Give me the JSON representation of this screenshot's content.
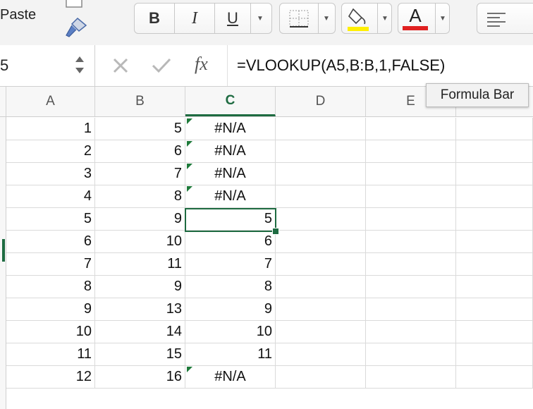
{
  "ribbon": {
    "paste_label": "Paste",
    "bold_label": "B",
    "italic_label": "I",
    "underline_label": "U",
    "font_color_label": "A",
    "fill_color": "#ffef00",
    "font_color": "#e02020"
  },
  "formula_bar": {
    "name_box": "5",
    "fx_label": "fx",
    "formula": "=VLOOKUP(A5,B:B,1,FALSE)",
    "tooltip": "Formula Bar"
  },
  "sheet": {
    "columns": [
      "A",
      "B",
      "C",
      "D",
      "E"
    ],
    "selected_column": "C",
    "rows": [
      {
        "a": "1",
        "b": "5",
        "c": "#N/A"
      },
      {
        "a": "2",
        "b": "6",
        "c": "#N/A"
      },
      {
        "a": "3",
        "b": "7",
        "c": "#N/A"
      },
      {
        "a": "4",
        "b": "8",
        "c": "#N/A"
      },
      {
        "a": "5",
        "b": "9",
        "c": "5"
      },
      {
        "a": "6",
        "b": "10",
        "c": "6"
      },
      {
        "a": "7",
        "b": "11",
        "c": "7"
      },
      {
        "a": "8",
        "b": "9",
        "c": "8"
      },
      {
        "a": "9",
        "b": "13",
        "c": "9"
      },
      {
        "a": "10",
        "b": "14",
        "c": "10"
      },
      {
        "a": "11",
        "b": "15",
        "c": "11"
      },
      {
        "a": "12",
        "b": "16",
        "c": "#N/A"
      }
    ],
    "accent_color": "#1e6b41"
  }
}
